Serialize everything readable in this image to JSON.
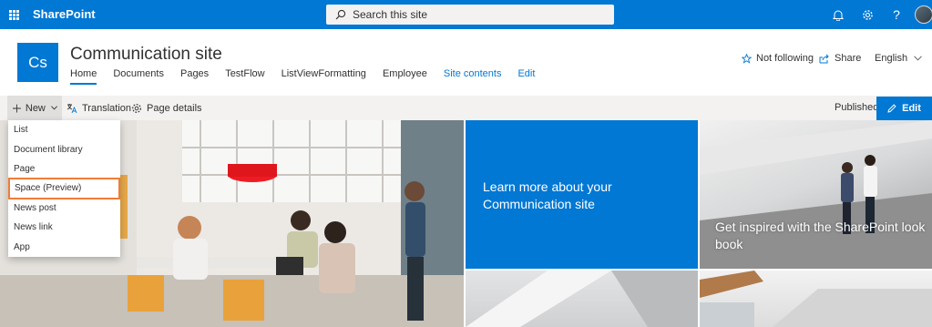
{
  "suite": {
    "brand": "SharePoint",
    "search_placeholder": "Search this site",
    "help_label": "?"
  },
  "site": {
    "logo_text": "Cs",
    "title": "Communication site",
    "nav": [
      {
        "label": "Home",
        "active": true
      },
      {
        "label": "Documents"
      },
      {
        "label": "Pages"
      },
      {
        "label": "TestFlow"
      },
      {
        "label": "ListViewFormatting"
      },
      {
        "label": "Employee"
      },
      {
        "label": "Site contents"
      },
      {
        "label": "Edit"
      }
    ],
    "follow_label": "Not following",
    "share_label": "Share",
    "language_label": "English"
  },
  "commandbar": {
    "new_label": "New",
    "translation_label": "Translation",
    "page_details_label": "Page details",
    "status": "Published",
    "edit_label": "Edit"
  },
  "new_menu": {
    "items": [
      "List",
      "Document library",
      "Page",
      "Space (Preview)",
      "News post",
      "News link",
      "App"
    ],
    "highlighted_index": 3
  },
  "hero": {
    "tile1_text": "Learn more about your Communication site",
    "tile2_text": "Get inspired with the SharePoint look book"
  },
  "colors": {
    "brand_blue": "#0078d4",
    "highlight_outline": "#f07d38",
    "command_bar": "#f3f2f1"
  }
}
